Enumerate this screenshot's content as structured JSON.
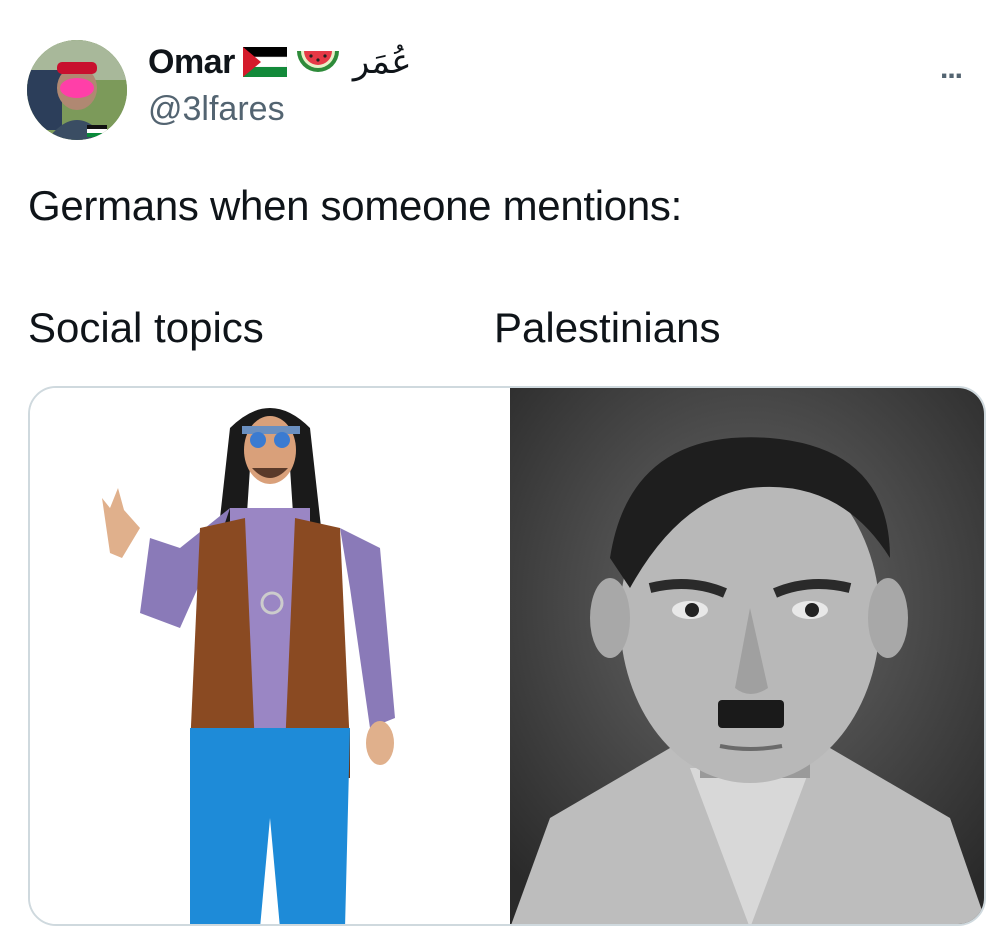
{
  "author": {
    "display_name": "Omar",
    "arabic_name": "عُمَر",
    "handle": "@3lfares",
    "emojis": [
      "palestine-flag-icon",
      "watermelon-icon"
    ]
  },
  "tweet": {
    "text": "Germans when someone mentions:"
  },
  "meme": {
    "left_caption": "Social topics",
    "right_caption": "Palestinians"
  },
  "menu": {
    "more_label": "..."
  },
  "colors": {
    "text": "#0f1419",
    "secondary": "#536471",
    "border": "#cfd9de"
  }
}
